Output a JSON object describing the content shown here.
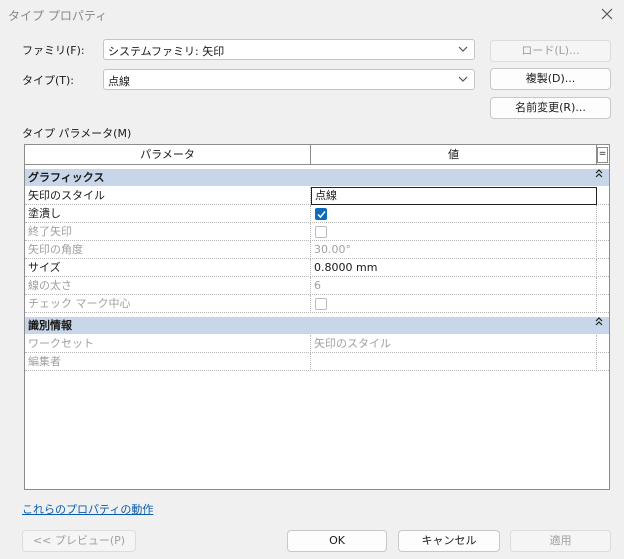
{
  "window": {
    "title": "タイプ プロパティ"
  },
  "family": {
    "label": "ファミリ(F):",
    "value": "システムファミリ: 矢印"
  },
  "type": {
    "label": "タイプ(T):",
    "value": "点線"
  },
  "buttons": {
    "load": "ロード(L)...",
    "duplicate": "複製(D)...",
    "rename": "名前変更(R)...",
    "preview": "<< プレビュー(P)",
    "ok": "OK",
    "cancel": "キャンセル",
    "apply": "適用"
  },
  "params_label": "タイプ パラメータ(M)",
  "table": {
    "headers": {
      "param": "パラメータ",
      "value": "値",
      "sort": "="
    },
    "groups": [
      {
        "name": "グラフィックス",
        "rows": [
          {
            "name": "矢印のスタイル",
            "value": "点線"
          },
          {
            "name": "塗潰し",
            "value": ""
          },
          {
            "name": "終了矢印",
            "value": ""
          },
          {
            "name": "矢印の角度",
            "value": "30.00°"
          },
          {
            "name": "サイズ",
            "value": "0.8000 mm"
          },
          {
            "name": "線の太さ",
            "value": "6"
          },
          {
            "name": "チェック マーク中心",
            "value": ""
          }
        ]
      },
      {
        "name": "識別情報",
        "rows": [
          {
            "name": "ワークセット",
            "value": "矢印のスタイル"
          },
          {
            "name": "編集者",
            "value": ""
          }
        ]
      }
    ]
  },
  "properties_link": "これらのプロパティの動作",
  "collapse_glyph": "⌃"
}
